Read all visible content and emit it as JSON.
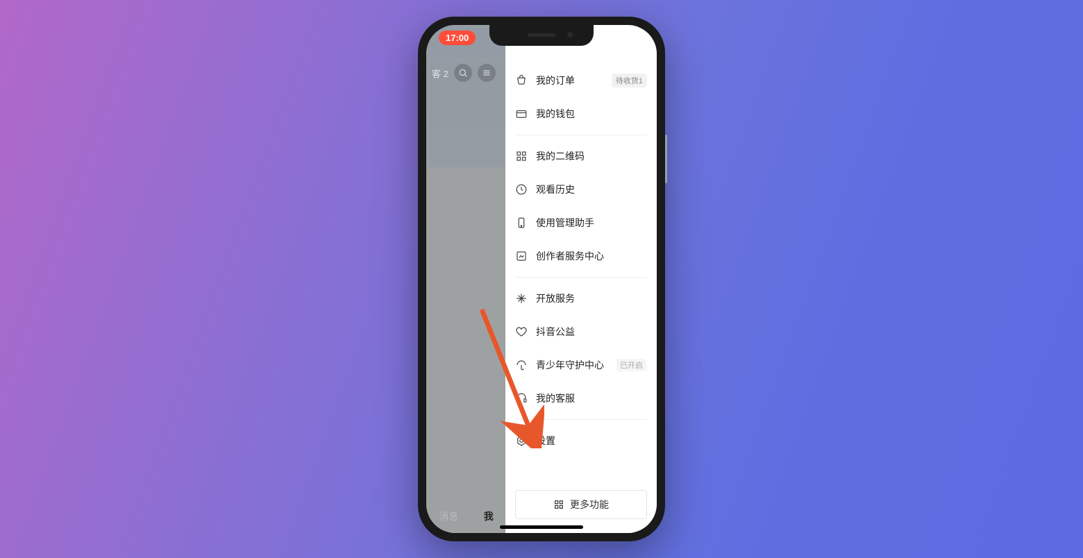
{
  "status": {
    "time": "17:00"
  },
  "bg": {
    "visitor_label": "客 2",
    "tab_messages": "消息",
    "tab_me": "我"
  },
  "menu": {
    "orders": {
      "label": "我的订单",
      "badge": "待收货1"
    },
    "wallet": {
      "label": "我的钱包"
    },
    "qrcode": {
      "label": "我的二维码"
    },
    "history": {
      "label": "观看历史"
    },
    "assistant": {
      "label": "使用管理助手"
    },
    "creator": {
      "label": "创作者服务中心"
    },
    "open_service": {
      "label": "开放服务"
    },
    "charity": {
      "label": "抖音公益"
    },
    "teen": {
      "label": "青少年守护中心",
      "tag": "已开启"
    },
    "support": {
      "label": "我的客服"
    },
    "settings": {
      "label": "设置"
    }
  },
  "more_button": "更多功能"
}
